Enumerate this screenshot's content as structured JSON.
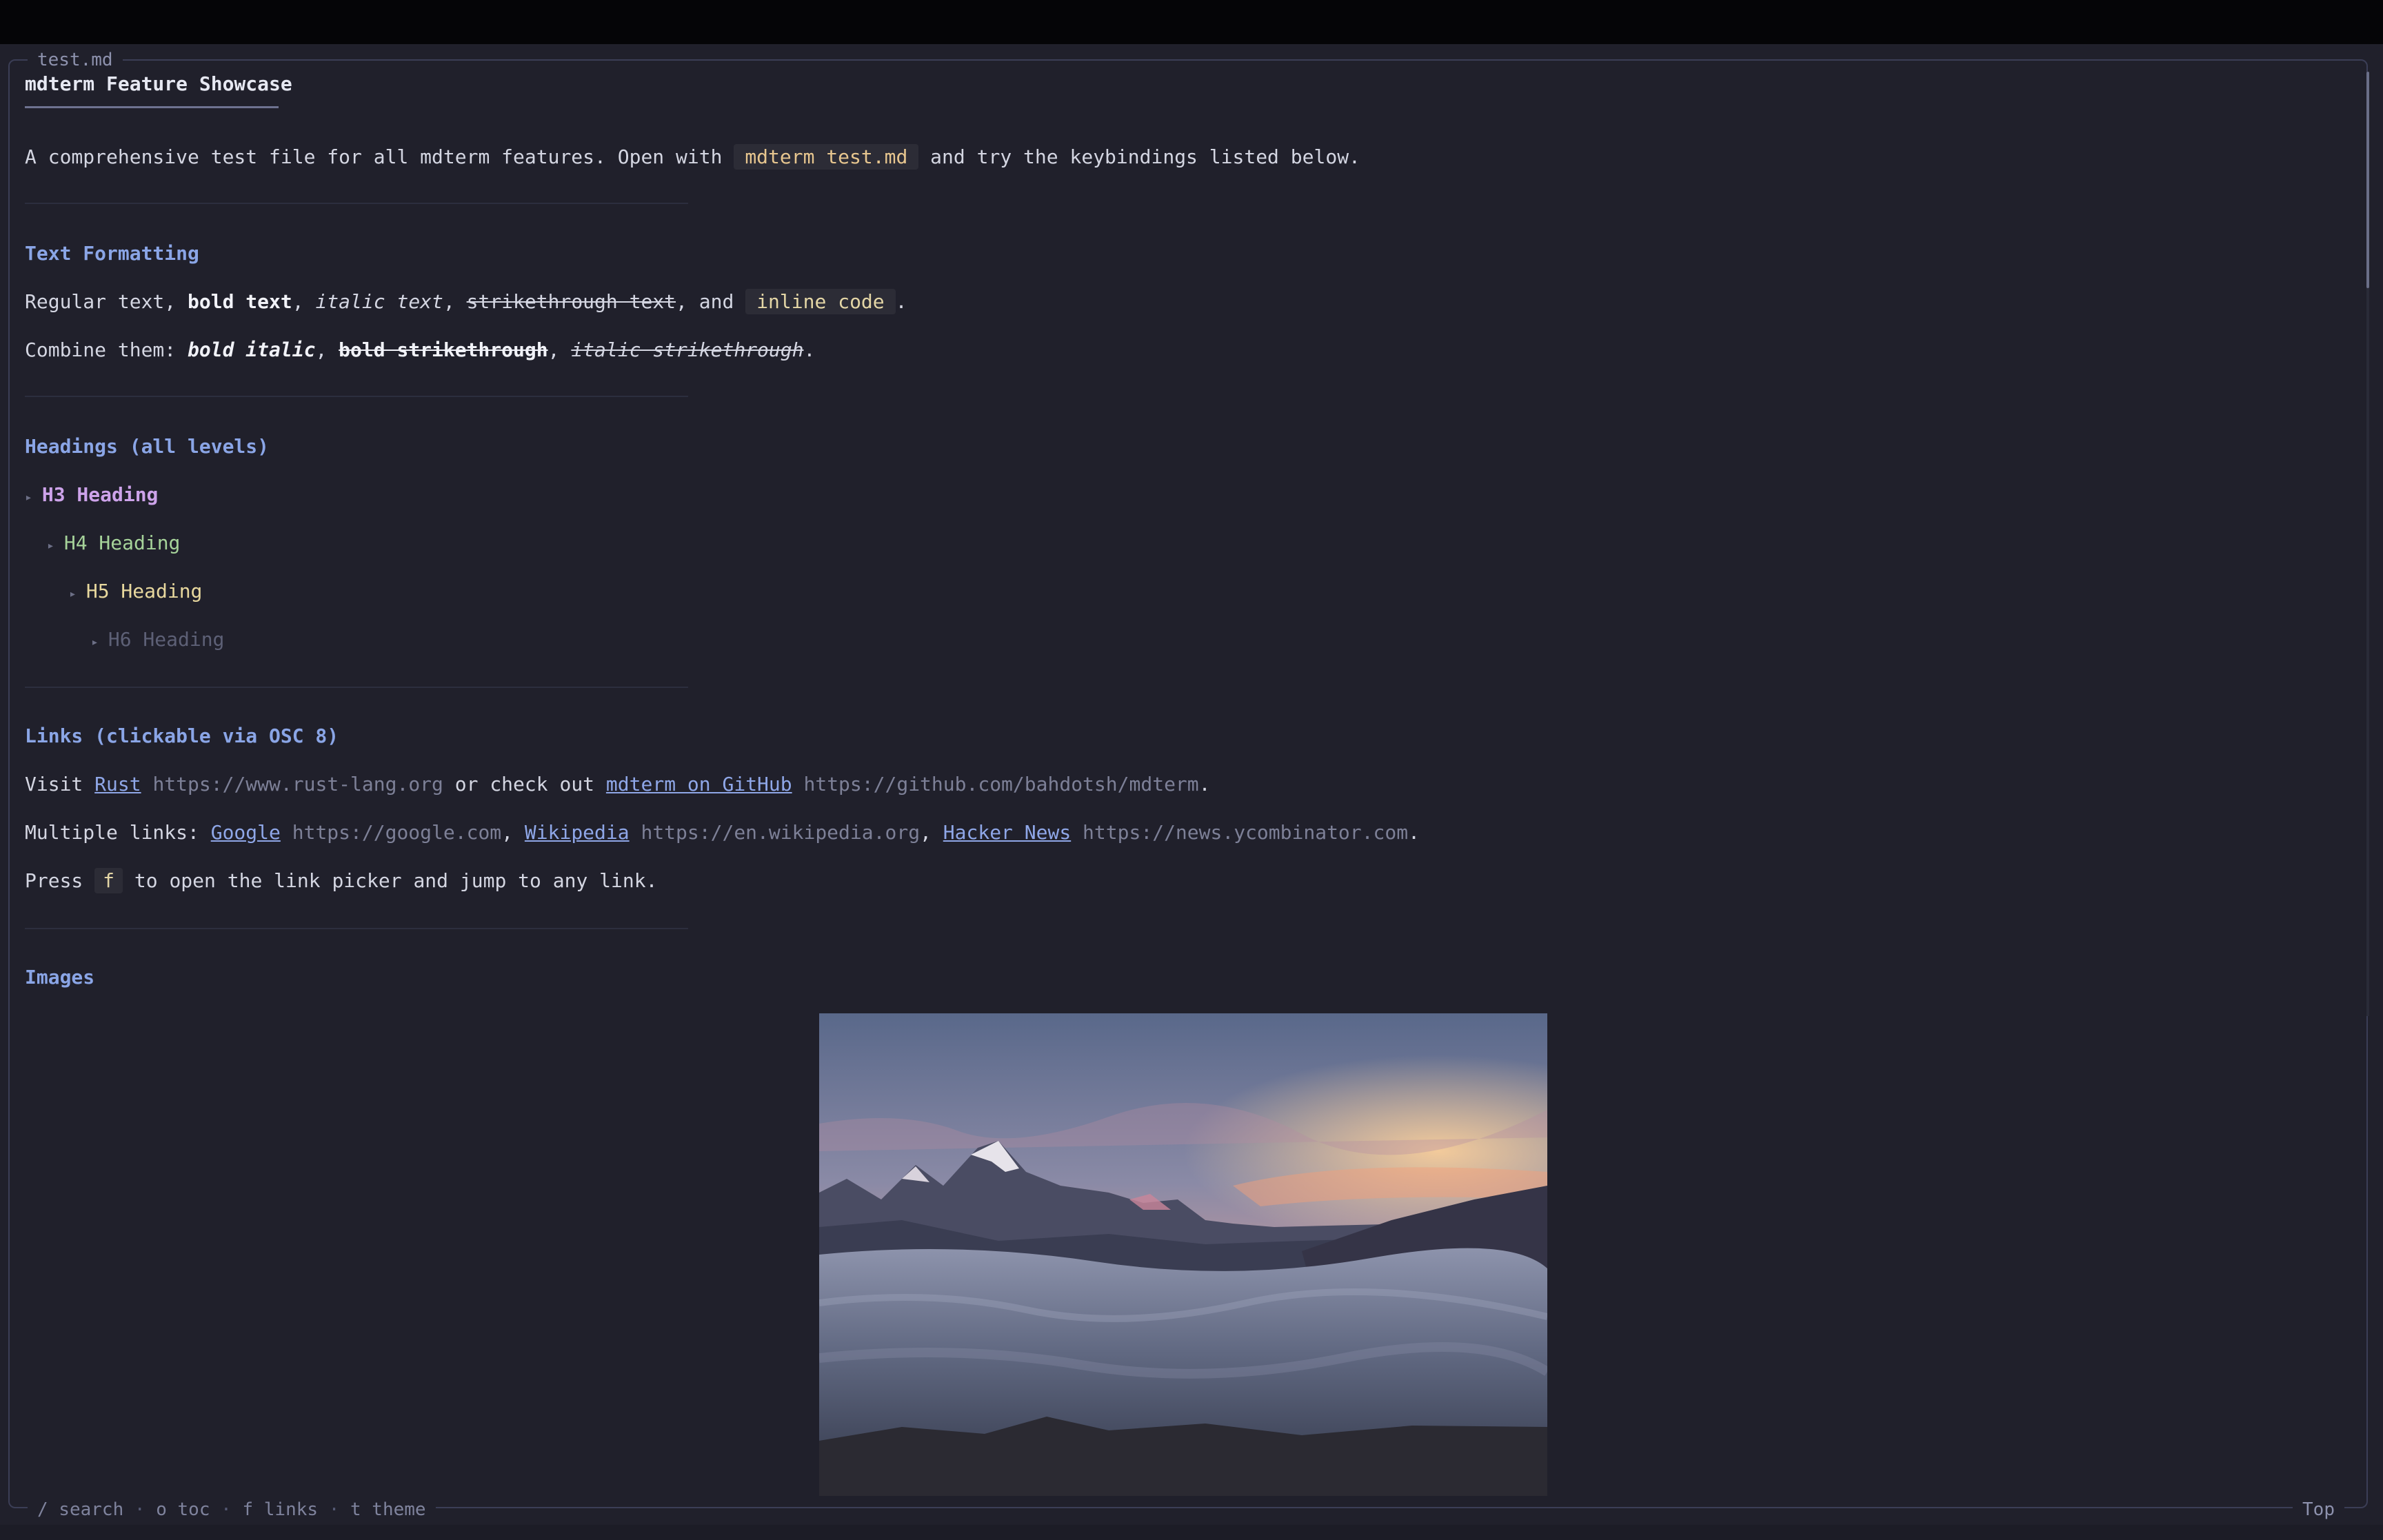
{
  "window": {
    "tab_title": "test.md"
  },
  "doc": {
    "title": "mdterm Feature Showcase",
    "intro": {
      "before": "A comprehensive test file for all mdterm features. Open with ",
      "code": "mdterm test.md",
      "after": " and try the keybindings listed below."
    },
    "formatting": {
      "heading": "Text Formatting",
      "line1": {
        "regular": "Regular text, ",
        "bold": "bold text",
        "sep1": ", ",
        "italic": "italic text",
        "sep2": ", ",
        "strike": "strikethrough text",
        "sep3": ", and ",
        "code": "inline code",
        "end": "."
      },
      "line2": {
        "label": "Combine them: ",
        "bold_italic": "bold italic",
        "sep1": ", ",
        "bold_strike": "bold strikethrough",
        "sep2": ", ",
        "italic_strike": "italic strikethrough",
        "end": "."
      }
    },
    "headings": {
      "heading": "Headings (all levels)",
      "marker": "▸",
      "h3": "H3 Heading",
      "h4": "H4 Heading",
      "h5": "H5 Heading",
      "h6": "H6 Heading"
    },
    "links": {
      "heading": "Links (clickable via OSC 8)",
      "line1": {
        "visit": "Visit ",
        "rust_text": "Rust",
        "rust_url": " https://www.rust-lang.org",
        "mid": " or check out ",
        "gh_text": "mdterm on GitHub",
        "gh_url": " https://github.com/bahdotsh/mdterm",
        "end": "."
      },
      "line2": {
        "label": "Multiple links: ",
        "google_text": "Google",
        "google_url": " https://google.com",
        "sep1": ", ",
        "wiki_text": "Wikipedia",
        "wiki_url": " https://en.wikipedia.org",
        "sep2": ", ",
        "hn_text": "Hacker News",
        "hn_url": " https://news.ycombinator.com",
        "end": "."
      },
      "line3": {
        "press": "Press ",
        "key": "f",
        "rest": " to open the link picker and jump to any link."
      }
    },
    "images": {
      "heading": "Images"
    }
  },
  "statusbar": {
    "search": "/ search",
    "toc": "o toc",
    "links": "f links",
    "theme": "t theme",
    "separator": "·",
    "position": "Top"
  },
  "colors": {
    "background": "#20202b",
    "accent_heading": "#8aa5e6",
    "link": "#8fa7e8",
    "h3": "#cda3ea",
    "h4": "#a6d39a",
    "h5": "#e8d89e"
  }
}
